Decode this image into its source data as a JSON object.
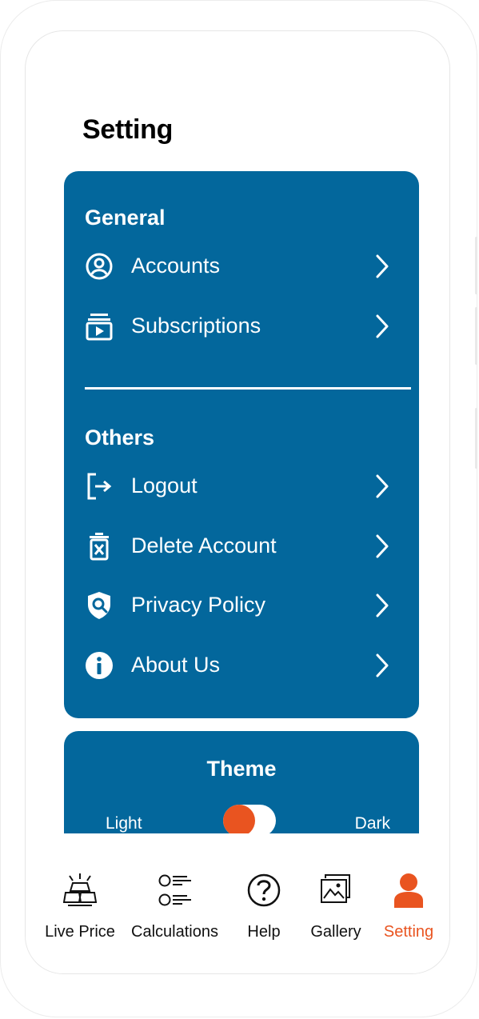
{
  "page": {
    "title": "Setting"
  },
  "general": {
    "title": "General",
    "items": [
      {
        "label": "Accounts",
        "icon": "user-circle-icon"
      },
      {
        "label": "Subscriptions",
        "icon": "subscriptions-icon"
      }
    ]
  },
  "others": {
    "title": "Others",
    "items": [
      {
        "label": "Logout",
        "icon": "logout-icon"
      },
      {
        "label": "Delete Account",
        "icon": "trash-icon"
      },
      {
        "label": "Privacy Policy",
        "icon": "shield-search-icon"
      },
      {
        "label": "About Us",
        "icon": "info-icon"
      }
    ]
  },
  "theme": {
    "title": "Theme",
    "light_label": "Light",
    "dark_label": "Dark",
    "dark_enabled": false
  },
  "nav": {
    "items": [
      {
        "label": "Live Price",
        "icon": "gold-bars-icon",
        "active": false
      },
      {
        "label": "Calculations",
        "icon": "list-icon",
        "active": false
      },
      {
        "label": "Help",
        "icon": "question-icon",
        "active": false
      },
      {
        "label": "Gallery",
        "icon": "gallery-icon",
        "active": false
      },
      {
        "label": "Setting",
        "icon": "person-icon",
        "active": true
      }
    ]
  },
  "colors": {
    "card": "#03679c",
    "accent": "#e95420",
    "text_on_card": "#ffffff"
  }
}
